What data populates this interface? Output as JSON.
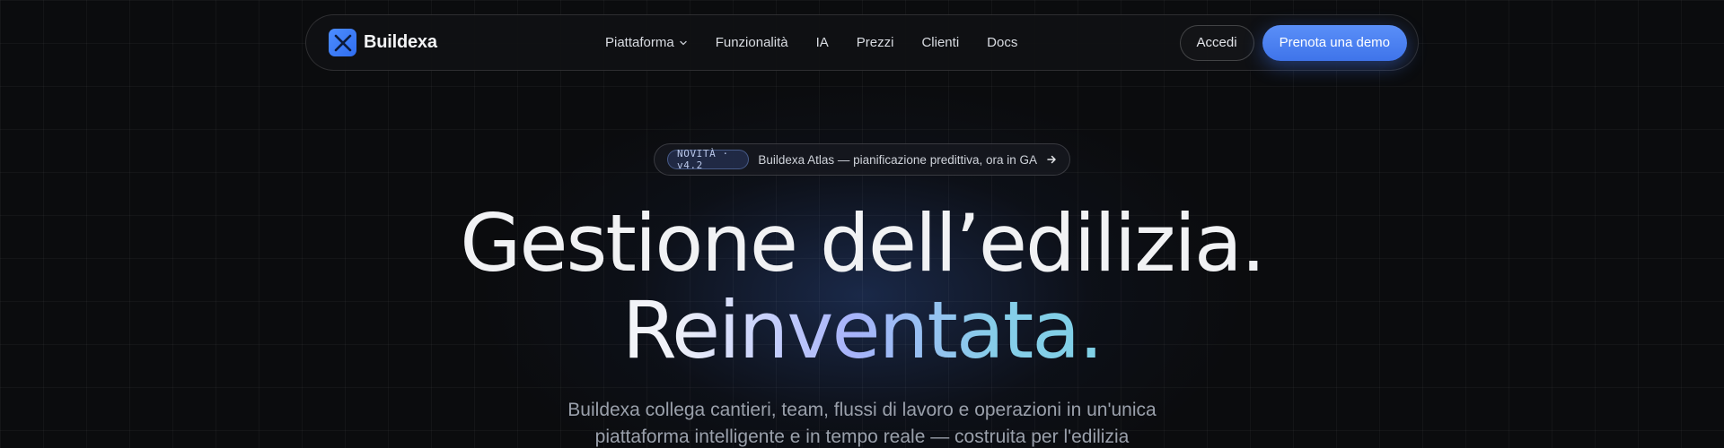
{
  "brand": {
    "name": "Buildexa",
    "logo_icon": "x-mark-logo-icon",
    "logo_color": "#3f7ef6"
  },
  "nav": {
    "links": [
      {
        "label": "Piattaforma",
        "has_dropdown": true
      },
      {
        "label": "Funzionalità"
      },
      {
        "label": "IA"
      },
      {
        "label": "Prezzi"
      },
      {
        "label": "Clienti"
      },
      {
        "label": "Docs"
      }
    ],
    "login_label": "Accedi",
    "demo_label": "Prenota una demo"
  },
  "announcement": {
    "badge": "NOVITÀ · v4.2",
    "text": "Buildexa Atlas — pianificazione predittiva, ora in GA",
    "icon": "arrow-right-icon"
  },
  "hero": {
    "title_line1": "Gestione dell’edilizia.",
    "title_line2": "Reinventata.",
    "subtitle_line1": "Buildexa collega cantieri, team, flussi di lavoro e operazioni in un'unica",
    "subtitle_line2": "piattaforma intelligente e in tempo reale — costruita per l'edilizia"
  },
  "colors": {
    "background": "#0b0c0e",
    "accent": "#4d82f0",
    "gradient_start": "#c3cdfb",
    "gradient_end": "#7fd0e6"
  }
}
